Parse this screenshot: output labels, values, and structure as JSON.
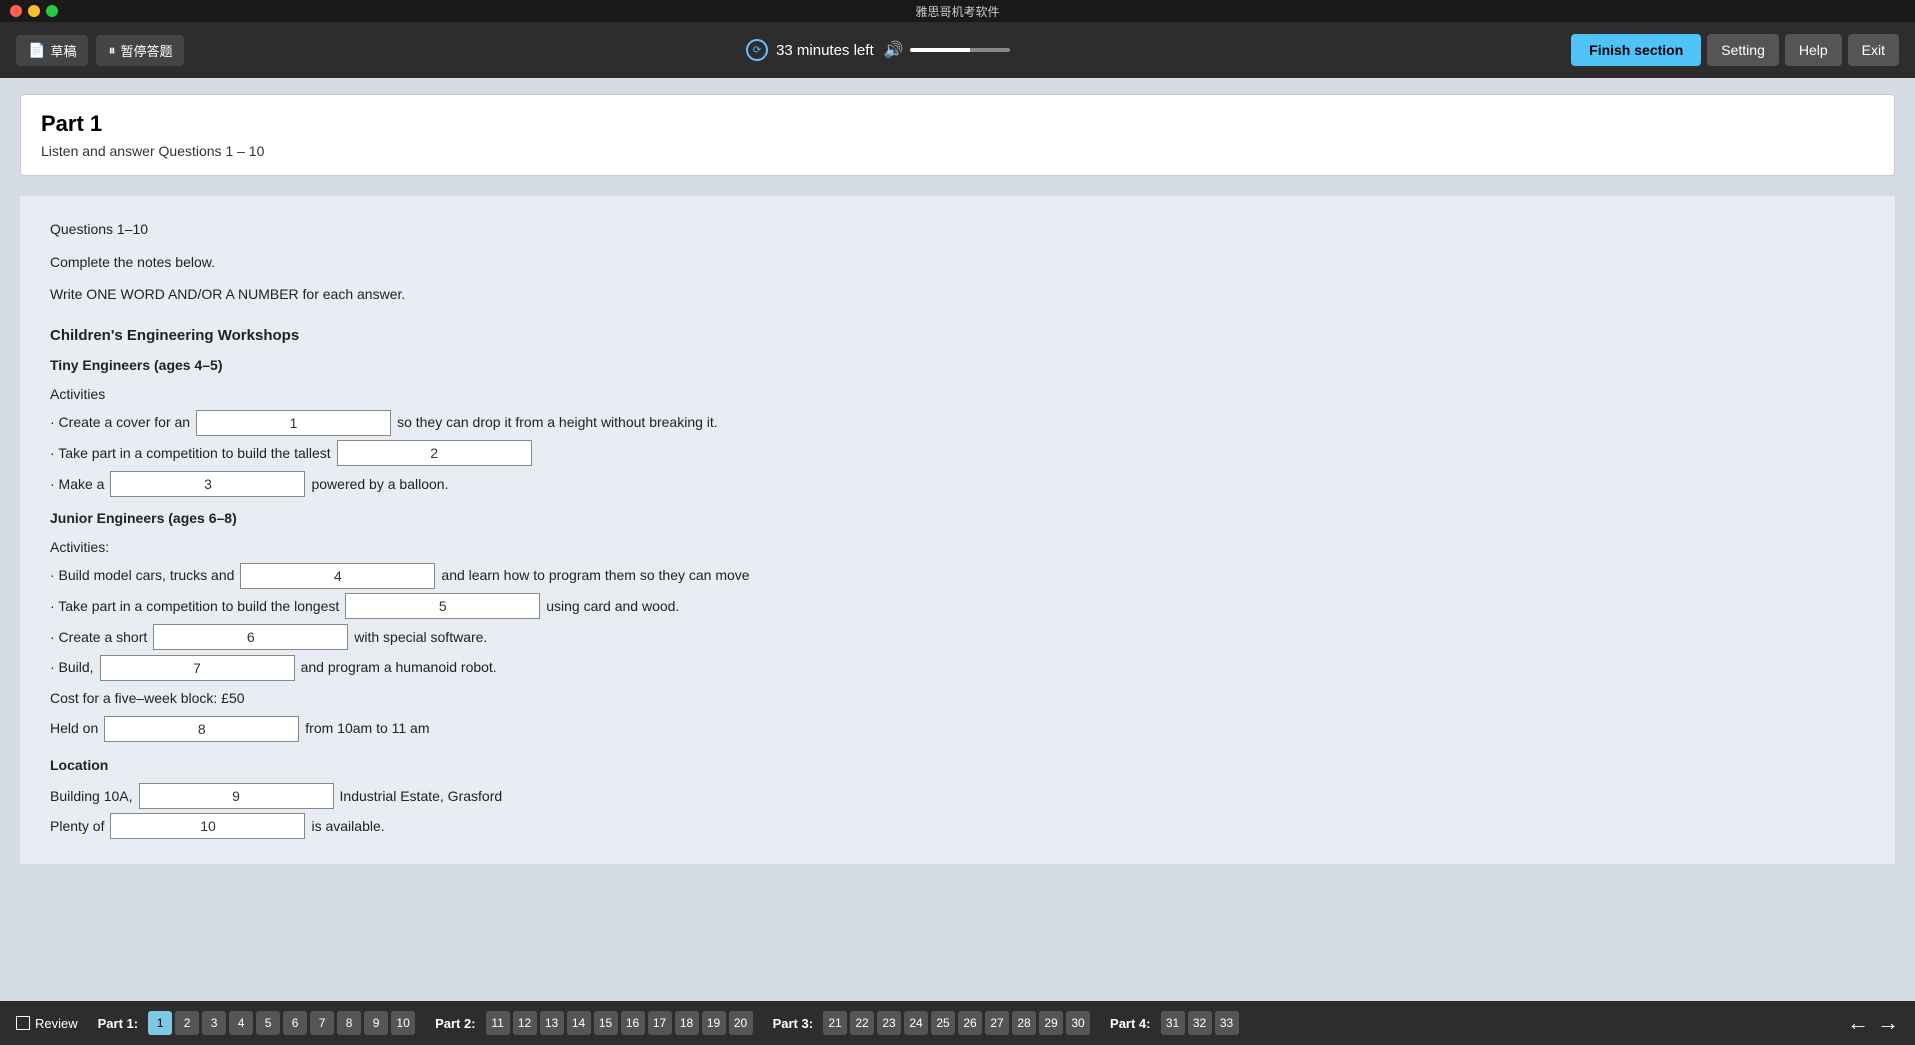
{
  "titleBar": {
    "appName": "雅思哥机考软件"
  },
  "toolbar": {
    "draftBtn": "草稿",
    "pauseBtn": "暂停答题",
    "timer": "33 minutes left",
    "finishBtn": "Finish section",
    "settingBtn": "Setting",
    "helpBtn": "Help",
    "exitBtn": "Exit"
  },
  "part": {
    "title": "Part 1",
    "subtitle": "Listen and answer Questions 1 – 10"
  },
  "instructions": {
    "line1": "Questions 1–10",
    "line2": "Complete the notes below.",
    "line3": "Write ONE WORD AND/OR A NUMBER for each answer."
  },
  "sections": {
    "mainTitle": "Children's Engineering Workshops",
    "section1Title": "Tiny Engineers (ages 4–5)",
    "section1Label": "Activities",
    "section1Items": [
      {
        "prefix": "· Create a cover for an",
        "inputId": "1",
        "inputValue": "1",
        "suffix": "so they can drop it from a height without breaking it."
      },
      {
        "prefix": "· Take part in a competition to build the tallest",
        "inputId": "2",
        "inputValue": "2",
        "suffix": ""
      },
      {
        "prefix": "· Make a",
        "inputId": "3",
        "inputValue": "3",
        "suffix": "powered by a balloon."
      }
    ],
    "section2Title": "Junior Engineers (ages 6–8)",
    "section2Label": "Activities:",
    "section2Items": [
      {
        "prefix": "· Build model cars, trucks and",
        "inputId": "4",
        "inputValue": "4",
        "suffix": "and learn how to program them so they can move"
      },
      {
        "prefix": "· Take part in a competition to build the longest",
        "inputId": "5",
        "inputValue": "5",
        "suffix": "using card and wood."
      },
      {
        "prefix": "· Create a short",
        "inputId": "6",
        "inputValue": "6",
        "suffix": "with special software."
      },
      {
        "prefix": "· Build,",
        "inputId": "7",
        "inputValue": "7",
        "suffix": "and program a humanoid robot."
      }
    ],
    "costLine": "Cost for a five–week block: £50",
    "heldOnPrefix": "Held on",
    "heldOnInputId": "8",
    "heldOnInputValue": "8",
    "heldOnSuffix": "from 10am to 11 am",
    "locationTitle": "Location",
    "buildingPrefix": "Building 10A,",
    "locationInputId": "9",
    "locationInputValue": "9",
    "locationSuffix": "Industrial Estate, Grasford",
    "plentyPrefix": "Plenty of",
    "plentyInputId": "10",
    "plentyInputValue": "10",
    "plentySuffix": "is available."
  },
  "bottomNav": {
    "reviewLabel": "Review",
    "part1Label": "Part 1:",
    "part1Nums": [
      1,
      2,
      3,
      4,
      5,
      6,
      7,
      8,
      9,
      10
    ],
    "part2Label": "Part 2:",
    "part2Nums": [
      11,
      12,
      13,
      14,
      15,
      16,
      17,
      18,
      19,
      20
    ],
    "part3Label": "Part 3:",
    "part3Nums": [
      21,
      22,
      23,
      24,
      25,
      26,
      27,
      28,
      29,
      30
    ],
    "part4Label": "Part 4:",
    "part4Nums": [
      31,
      32,
      33
    ]
  }
}
